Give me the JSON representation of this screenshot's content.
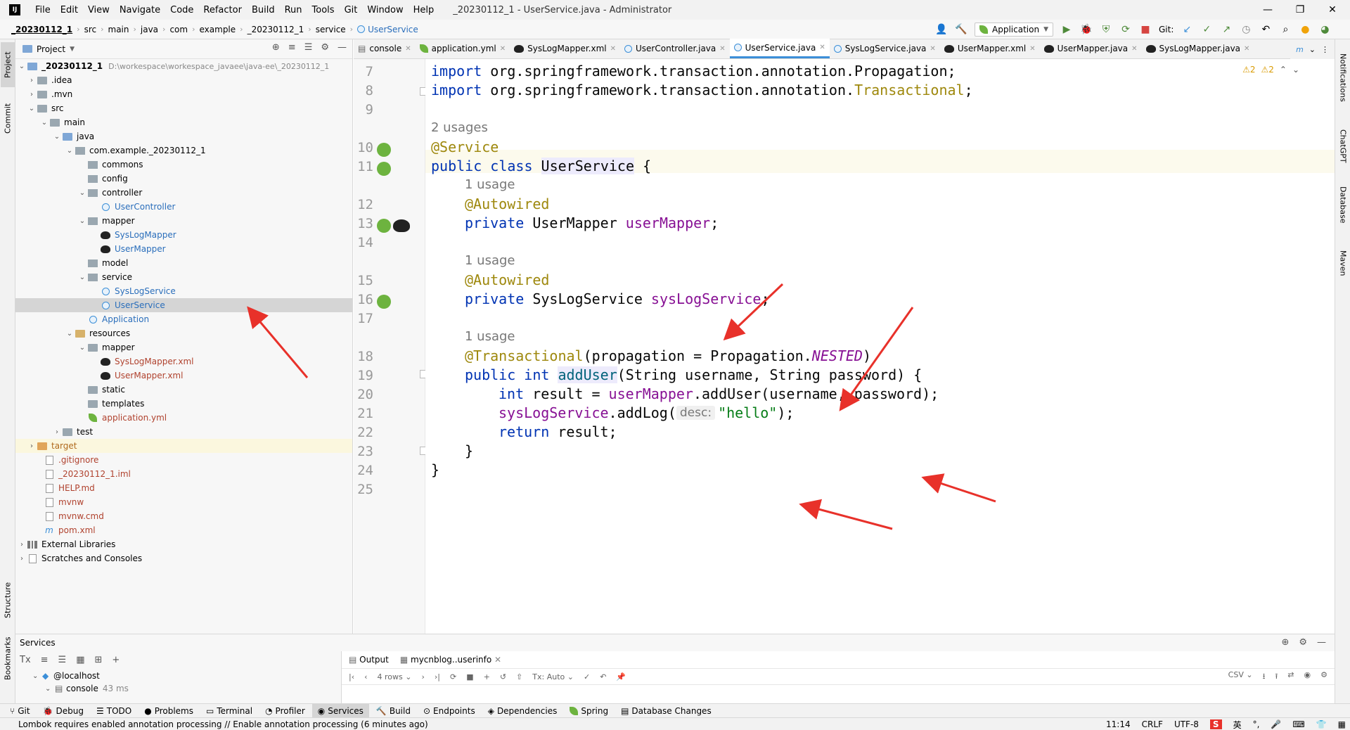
{
  "menubar": {
    "logo": "IJ",
    "items": [
      "File",
      "Edit",
      "View",
      "Navigate",
      "Code",
      "Refactor",
      "Build",
      "Run",
      "Tools",
      "Git",
      "Window",
      "Help"
    ],
    "window_title": "_20230112_1 - UserService.java - Administrator",
    "minimize": "—",
    "restore": "❐",
    "close": "✕"
  },
  "navbar": {
    "breadcrumbs": [
      "_20230112_1",
      "src",
      "main",
      "java",
      "com",
      "example",
      "_20230112_1",
      "service",
      "UserService"
    ],
    "run_config": "Application",
    "git_label": "Git:"
  },
  "left_strip": {
    "project": "Project",
    "commit": "Commit",
    "structure": "Structure",
    "bookmarks": "Bookmarks"
  },
  "right_strip": {
    "notifications": "Notifications",
    "chatgpt": "ChatGPT",
    "database": "Database",
    "maven": "Maven"
  },
  "project_panel": {
    "title": "Project",
    "root_name": "_20230112_1",
    "root_path": "D:\\workespace\\workespace_javaee\\java-ee\\_20230112_1",
    "items": {
      "idea": ".idea",
      "mvn": ".mvn",
      "src": "src",
      "main": "main",
      "java": "java",
      "pkg": "com.example._20230112_1",
      "commons": "commons",
      "config": "config",
      "controller": "controller",
      "user_controller": "UserController",
      "mapper": "mapper",
      "syslog_mapper": "SysLogMapper",
      "user_mapper": "UserMapper",
      "model": "model",
      "service": "service",
      "syslog_service": "SysLogService",
      "user_service": "UserService",
      "application": "Application",
      "resources": "resources",
      "res_mapper": "mapper",
      "syslog_mapper_xml": "SysLogMapper.xml",
      "user_mapper_xml": "UserMapper.xml",
      "static": "static",
      "templates": "templates",
      "application_yml": "application.yml",
      "test": "test",
      "target": "target",
      "gitignore": ".gitignore",
      "iml": "_20230112_1.iml",
      "help": "HELP.md",
      "mvnw": "mvnw",
      "mvnw_cmd": "mvnw.cmd",
      "pom": "pom.xml",
      "ext_libs": "External Libraries",
      "scratches": "Scratches and Consoles"
    }
  },
  "editor_tabs": [
    {
      "label": "console"
    },
    {
      "label": "application.yml"
    },
    {
      "label": "SysLogMapper.xml"
    },
    {
      "label": "UserController.java"
    },
    {
      "label": "UserService.java"
    },
    {
      "label": "SysLogService.java"
    },
    {
      "label": "UserMapper.xml"
    },
    {
      "label": "UserMapper.java"
    },
    {
      "label": "SysLogMapper.java"
    }
  ],
  "editor": {
    "warnings_a": "⚠2",
    "warnings_b": "⚠2",
    "line_numbers": [
      "7",
      "8",
      "9",
      "10",
      "11",
      "12",
      "13",
      "14",
      "15",
      "16",
      "17",
      "18",
      "19",
      "20",
      "21",
      "22",
      "23",
      "24",
      "25"
    ],
    "hints": {
      "usages_2": "2 usages",
      "usage_1": "1 usage"
    },
    "code": {
      "l7_kw": "import",
      "l7_rest": " org.springframework.transaction.annotation.Propagation;",
      "l8_kw": "import",
      "l8_pre": " org.springframework.transaction.annotation.",
      "l8_ann": "Transactional",
      "l8_end": ";",
      "l10": "@Service",
      "l11_kw": "public class ",
      "l11_name": "UserService",
      "l11_end": " {",
      "l12": "@Autowired",
      "l13_kw": "private ",
      "l13_type": "UserMapper ",
      "l13_fld": "userMapper",
      "l13_end": ";",
      "l15": "@Autowired",
      "l16_kw": "private ",
      "l16_type": "SysLogService ",
      "l16_fld": "sysLogService",
      "l16_end": ";",
      "l18_ann": "@Transactional",
      "l18_a": "(propagation = Propagation.",
      "l18_nested": "NESTED",
      "l18_b": ")",
      "l19_kw": "public int ",
      "l19_name": "addUser",
      "l19_rest": "(String username, String password) {",
      "l20_kw": "int",
      "l20_a": " result = ",
      "l20_fld": "userMapper",
      "l20_b": ".addUser(username, password);",
      "l21_fld": "sysLogService",
      "l21_a": ".addLog(",
      "l21_hint": "desc:",
      "l21_str": "\"hello\"",
      "l21_b": ");",
      "l22_kw": "return",
      "l22_rest": " result;",
      "l23": "}",
      "l24": "}"
    }
  },
  "services": {
    "title": "Services",
    "localhost": "@localhost",
    "console": "console",
    "console_time": "43 ms",
    "tab_output": "Output",
    "tab_table": "mycnblog..userinfo",
    "rows": "4 rows",
    "tx": "Tx: Auto",
    "csv": "CSV"
  },
  "bottom_tools": [
    "Git",
    "Debug",
    "TODO",
    "Problems",
    "Terminal",
    "Profiler",
    "Services",
    "Build",
    "Endpoints",
    "Dependencies",
    "Spring",
    "Database Changes"
  ],
  "statusbar": {
    "message": "Lombok requires enabled annotation processing // Enable annotation processing (6 minutes ago)",
    "position": "11:14",
    "line_sep": "CRLF",
    "encoding": "UTF-8",
    "ime": "英"
  },
  "colors": {
    "accent": "#3c8fd8",
    "arrow": "#e8312a",
    "keyword": "#0033b3",
    "annotation": "#9e880d",
    "field": "#871094",
    "string": "#067d17"
  }
}
